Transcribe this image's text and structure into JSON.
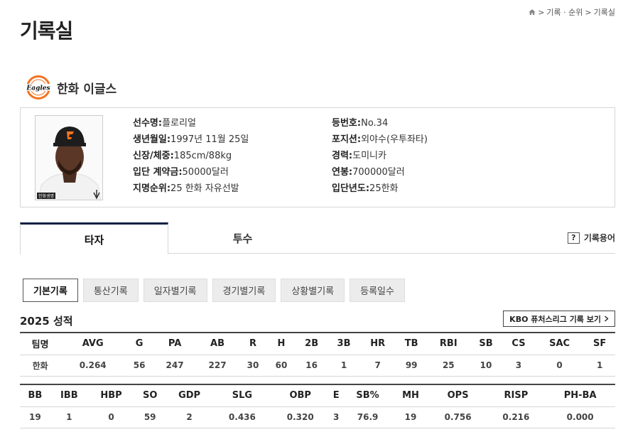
{
  "breadcrumb": {
    "sep": ">",
    "items": [
      "기록 · 순위",
      "기록실"
    ]
  },
  "page_title": "기록실",
  "team": {
    "name": "한화 이글스",
    "logo_text": "Eagles",
    "color": "#f37321"
  },
  "player": {
    "photo_badge": "한화생명",
    "col1": [
      {
        "label": "선수명:",
        "value": "플로리얼"
      },
      {
        "label": "생년월일:",
        "value": "1997년 11월 25일"
      },
      {
        "label": "신장/체중:",
        "value": "185cm/88kg"
      },
      {
        "label": "입단 계약금:",
        "value": "50000달러"
      },
      {
        "label": "지명순위:",
        "value": "25 한화 자유선발"
      }
    ],
    "col2": [
      {
        "label": "등번호:",
        "value": "No.34"
      },
      {
        "label": "포지션:",
        "value": "외야수(우투좌타)"
      },
      {
        "label": "경력:",
        "value": "도미니카"
      },
      {
        "label": "연봉:",
        "value": "700000달러"
      },
      {
        "label": "입단년도:",
        "value": "25한화"
      }
    ]
  },
  "tabs": {
    "batter": "타자",
    "pitcher": "투수",
    "glossary": "기록용어",
    "glossary_icon": "?"
  },
  "sub_tabs": [
    "기본기록",
    "통산기록",
    "일자별기록",
    "경기별기록",
    "상황별기록",
    "등록일수"
  ],
  "season_title": "2025 성적",
  "futures_btn": "KBO 퓨처스리그 기록 보기",
  "table1": {
    "headers": [
      "팀명",
      "AVG",
      "G",
      "PA",
      "AB",
      "R",
      "H",
      "2B",
      "3B",
      "HR",
      "TB",
      "RBI",
      "SB",
      "CS",
      "SAC",
      "SF"
    ],
    "row": [
      "한화",
      "0.264",
      "56",
      "247",
      "227",
      "30",
      "60",
      "16",
      "1",
      "7",
      "99",
      "25",
      "10",
      "3",
      "0",
      "1"
    ]
  },
  "table2": {
    "headers": [
      "BB",
      "IBB",
      "HBP",
      "SO",
      "GDP",
      "SLG",
      "OBP",
      "E",
      "SB%",
      "MH",
      "OPS",
      "RISP",
      "PH-BA"
    ],
    "row": [
      "19",
      "1",
      "0",
      "59",
      "2",
      "0.436",
      "0.320",
      "3",
      "76.9",
      "19",
      "0.756",
      "0.216",
      "0.000"
    ]
  },
  "colors": {
    "accent_navy": "#0b1f41",
    "border": "#d6d6d6"
  }
}
